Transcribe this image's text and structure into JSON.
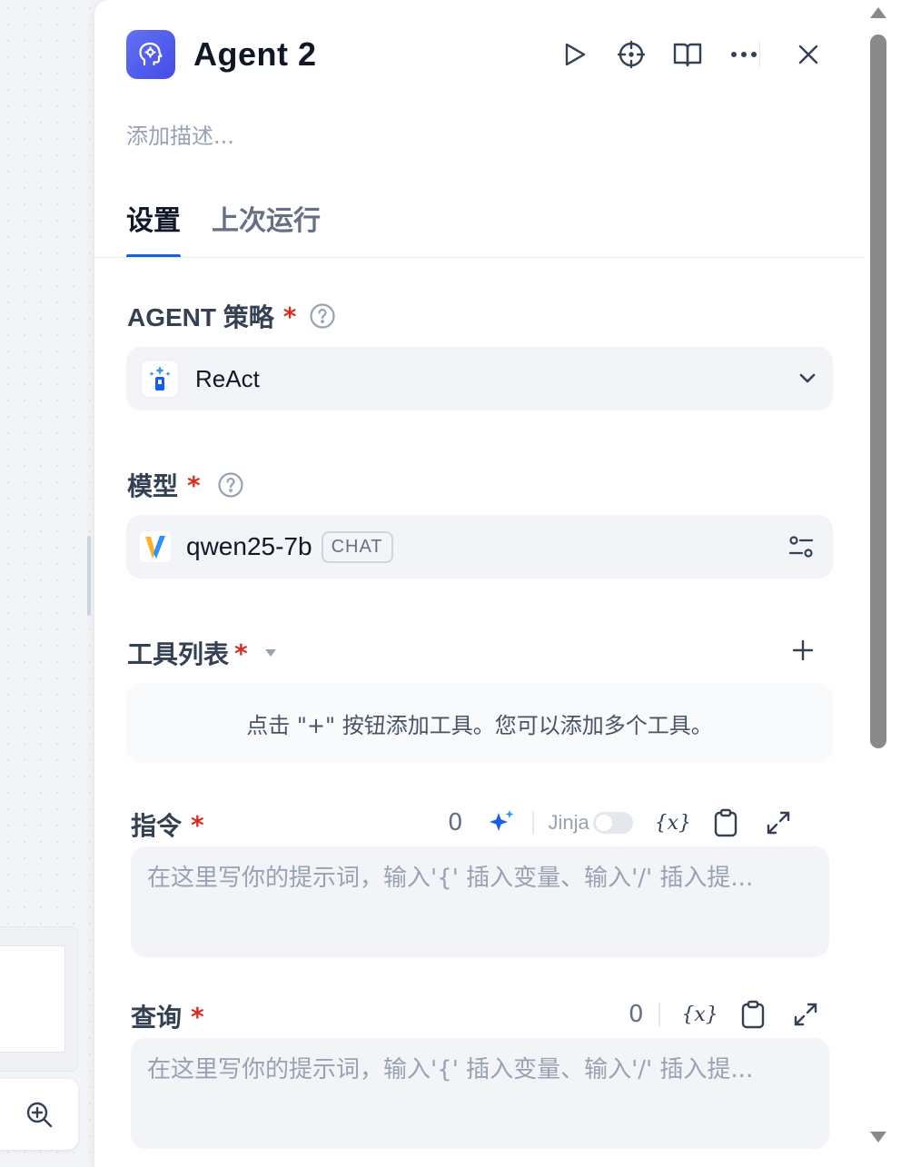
{
  "panel": {
    "title": "Agent 2",
    "description_placeholder": "添加描述...",
    "accent_color": "#155eef",
    "node_icon_color": "#6172f3"
  },
  "header_actions": {
    "run_icon": "play-icon",
    "locate_icon": "crosshair-icon",
    "docs_icon": "book-icon",
    "more_icon": "more-horizontal-icon",
    "close_icon": "close-icon"
  },
  "tabs": [
    {
      "label": "设置",
      "active": true
    },
    {
      "label": "上次运行",
      "active": false
    }
  ],
  "agent_strategy": {
    "label": "AGENT 策略",
    "required_mark": "*",
    "value": "ReAct"
  },
  "model": {
    "label": "模型",
    "required_mark": "*",
    "name": "qwen25-7b",
    "badge": "CHAT"
  },
  "tools": {
    "label": "工具列表",
    "required_mark": "*",
    "empty_text": "点击 \"+\" 按钮添加工具。您可以添加多个工具。"
  },
  "instruction": {
    "label": "指令",
    "required_mark": "*",
    "count": "0",
    "jinja_label": "Jinja",
    "jinja_enabled": false,
    "variable_button": "{x}",
    "placeholder": "在这里写你的提示词，输入'{' 插入变量、输入'/' 插入提..."
  },
  "query": {
    "label": "查询",
    "required_mark": "*",
    "count": "0",
    "variable_button": "{x}",
    "placeholder": "在这里写你的提示词，输入'{' 插入变量、输入'/' 插入提..."
  }
}
